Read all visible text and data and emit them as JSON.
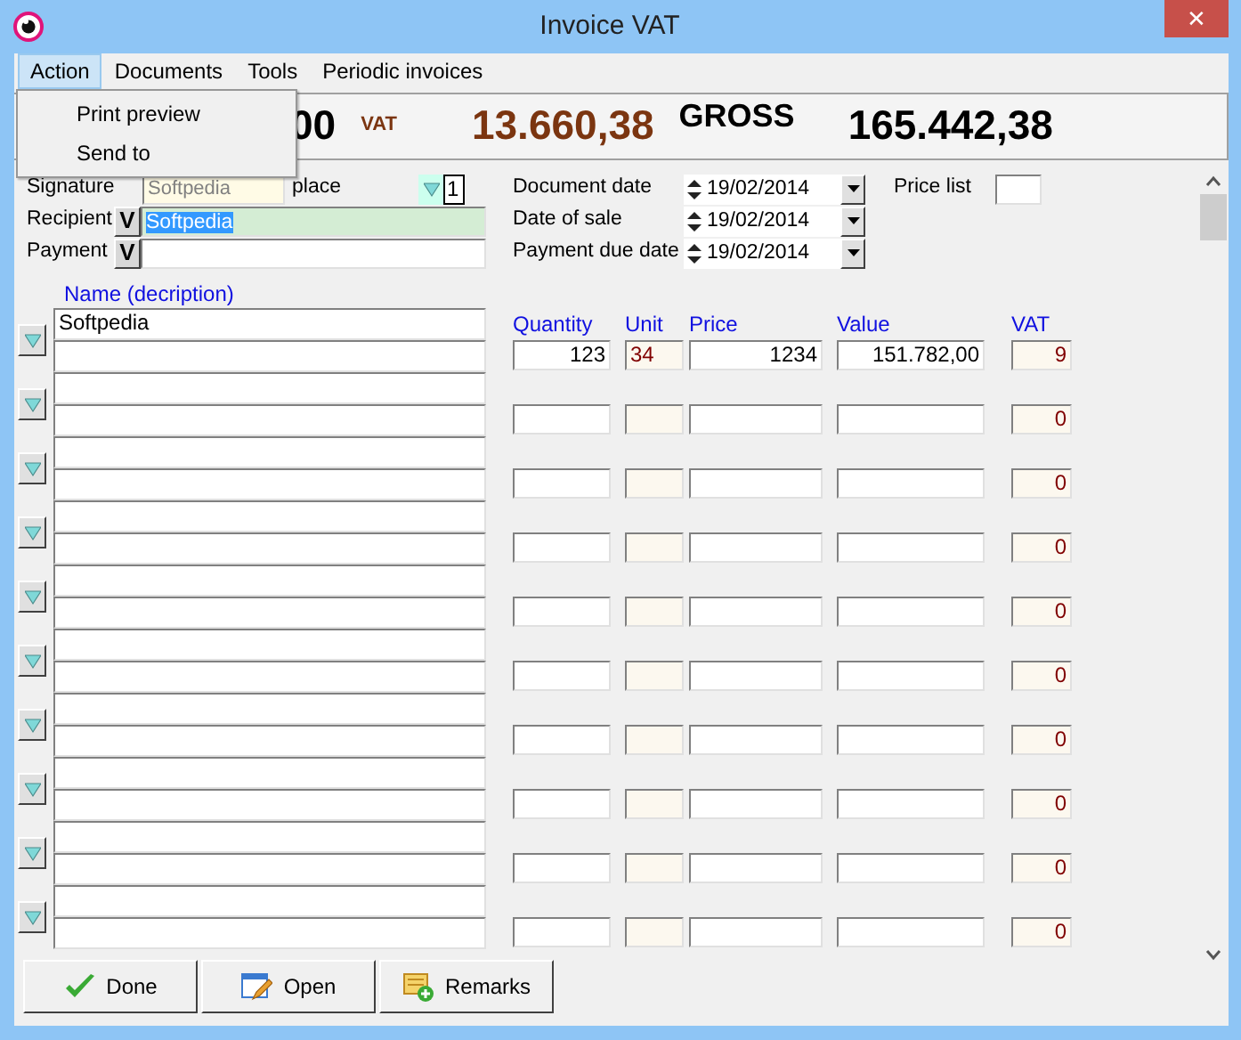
{
  "window": {
    "title": "Invoice VAT",
    "close": "✕"
  },
  "menu": [
    {
      "label": "Action",
      "selected": true
    },
    {
      "label": "Documents",
      "selected": false
    },
    {
      "label": "Tools",
      "selected": false
    },
    {
      "label": "Periodic invoices",
      "selected": false
    }
  ],
  "open_menu": {
    "items": [
      "Print preview",
      "Send to"
    ]
  },
  "totals": {
    "net": "00",
    "vat_label": "VAT",
    "vat": "13.660,38",
    "gross_label": "GROSS",
    "gross": "165.442,38"
  },
  "form": {
    "signature": {
      "label": "Signature",
      "value": "Softpedia",
      "disabled": true
    },
    "place": {
      "label": "place",
      "value": "1"
    },
    "recipient": {
      "label": "Recipient",
      "button": "V",
      "value": "Softpedia",
      "selected": true
    },
    "payment": {
      "label": "Payment",
      "button": "V"
    },
    "dates": [
      {
        "label": "Document date",
        "value": "19/02/2014"
      },
      {
        "label": "Date of sale",
        "value": "19/02/2014"
      },
      {
        "label": "Payment due date",
        "value": "19/02/2014"
      }
    ],
    "price_list": {
      "label": "Price list"
    }
  },
  "columns": {
    "name": "Name  (decription)",
    "quantity": "Quantity",
    "unit": "Unit",
    "price": "Price",
    "value": "Value",
    "vat": "VAT"
  },
  "items": [
    {
      "name": "Softpedia",
      "quantity": "123",
      "unit": "34",
      "price": "1234",
      "value": "151.782,00",
      "vat": "9"
    },
    {
      "vat": "0"
    },
    {
      "vat": "0"
    },
    {
      "vat": "0"
    },
    {
      "vat": "0"
    },
    {
      "vat": "0"
    },
    {
      "vat": "0"
    },
    {
      "vat": "0"
    },
    {
      "vat": "0"
    },
    {
      "vat": "0"
    }
  ],
  "buttons": [
    {
      "label": "Done",
      "kind": "done"
    },
    {
      "label": "Open",
      "kind": "open"
    },
    {
      "label": "Remarks",
      "kind": "remarks"
    }
  ]
}
